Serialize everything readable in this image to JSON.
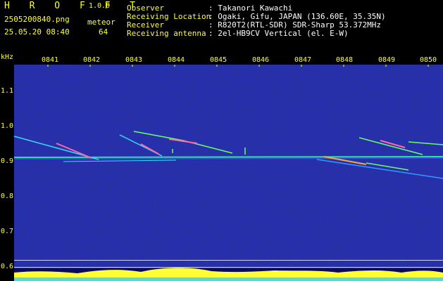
{
  "app": {
    "logo": "H R O F F T",
    "version": "1.0.0"
  },
  "capture": {
    "filename": "2505200840.png",
    "datetime": "25.05.20 08:40",
    "mode_label": "meteor",
    "count": "64"
  },
  "station": {
    "observer_label": "Observer",
    "observer_value": ": Takanori Kawachi",
    "location_label": "Receiving Location",
    "location_value": ": Ogaki, Gifu, JAPAN (136.60E, 35.35N)",
    "receiver_label": "Receiver",
    "receiver_value": ": R820T2(RTL-SDR) SDR-Sharp 53.372MHz",
    "antenna_label": "Receiving antenna",
    "antenna_value": ": 2el-HB9CV Vertical (el. E-W)"
  },
  "axes": {
    "y_unit": "kHz",
    "x_ticks": [
      "0841",
      "0842",
      "0843",
      "0844",
      "0845",
      "0846",
      "0847",
      "0848",
      "0849",
      "0850"
    ],
    "y_ticks": [
      "1.1",
      "1.0",
      "0.9",
      "0.8",
      "0.7",
      "0.6"
    ]
  },
  "colors": {
    "label_yellow": "#ffff33",
    "background": "#0a0a66",
    "trace": "#33ff99"
  }
}
